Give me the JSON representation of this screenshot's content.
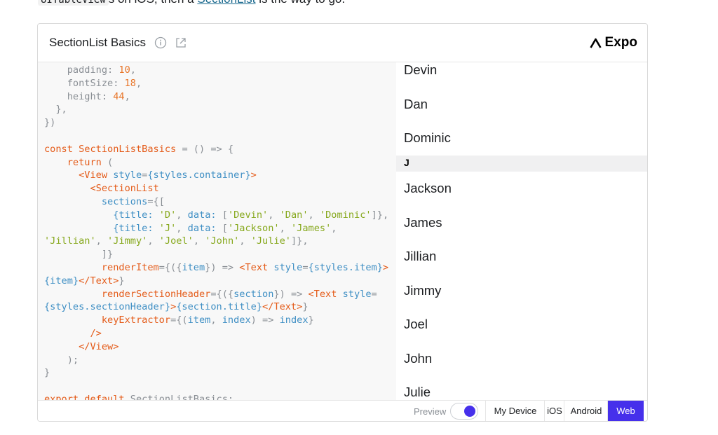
{
  "intro": {
    "code_text": "UITableView",
    "text_a": "s on iOS, then a ",
    "link": "SectionList",
    "text_b": " is the way to go."
  },
  "card": {
    "title": "SectionList Basics",
    "icons": {
      "info": "info-icon",
      "external": "external-link-icon",
      "expo": "expo-logo-icon"
    },
    "expo_label": "Expo"
  },
  "code_lines": [
    "    padding: 10,",
    "    fontSize: 18,",
    "    height: 44,",
    "  },",
    "})",
    "",
    "const SectionListBasics = () => {",
    "    return (",
    "      <View style={styles.container}>",
    "        <SectionList",
    "          sections={[",
    "            {title: 'D', data: ['Devin', 'Dan', 'Dominic']},",
    "            {title: 'J', data: ['Jackson', 'James',",
    "'Jillian', 'Jimmy', 'Joel', 'John', 'Julie']},",
    "          ]}",
    "          renderItem={({item}) => <Text style={styles.item}>",
    "{item}</Text>}",
    "          renderSectionHeader={({section}) => <Text style=",
    "{styles.sectionHeader}>{section.title}</Text>}",
    "          keyExtractor={(item, index) => index}",
    "        />",
    "      </View>",
    "    );",
    "}",
    "",
    "export default SectionListBasics;"
  ],
  "list": {
    "d_items": [
      "Devin",
      "Dan",
      "Dominic"
    ],
    "j_header": "J",
    "j_items": [
      "Jackson",
      "James",
      "Jillian",
      "Jimmy",
      "Joel",
      "John",
      "Julie"
    ]
  },
  "footer": {
    "preview_label": "Preview",
    "preview_on": true,
    "tabs": [
      "My Device",
      "iOS",
      "Android",
      "Web"
    ],
    "active_tab": "Web"
  },
  "colors": {
    "accent": "#4630eb",
    "keyword": "#e45b19",
    "number": "#e8762a",
    "string": "#86a81c",
    "attribute": "#3f8fc4"
  }
}
